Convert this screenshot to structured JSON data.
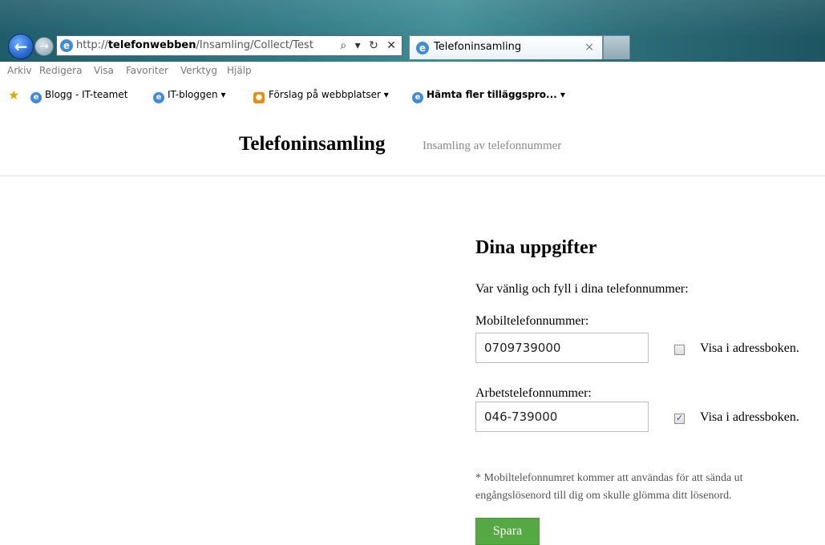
{
  "browser": {
    "url_prefix": "http://",
    "url_host": "telefonwebben",
    "url_path": "/Insamling/Collect/Test",
    "address_tools": "⌕ ▾ ↻ ✕",
    "tab_title": "Telefoninsamling",
    "tab_close": "×",
    "back_icon": "←",
    "forward_icon": "→",
    "ie_glyph": "e"
  },
  "menubar": {
    "items": [
      "Arkiv",
      "Redigera",
      "Visa",
      "Favoriter",
      "Verktyg",
      "Hjälp"
    ]
  },
  "favorites": {
    "star_icon": "★",
    "items": [
      {
        "label": "Blogg - IT-teamet",
        "arrow": ""
      },
      {
        "label": "IT-bloggen",
        "arrow": "▾"
      },
      {
        "label": "Förslag på webbplatser",
        "arrow": "▾"
      },
      {
        "label": "Hämta fler tilläggspro...",
        "arrow": "▾"
      }
    ]
  },
  "header": {
    "brand": "Telefoninsamling",
    "tagline": "Insamling av telefonnummer"
  },
  "form": {
    "heading": "Dina uppgifter",
    "intro": "Var vänlig och fyll i dina telefonnummer:",
    "mobile": {
      "label": "Mobiltelefonnummer:",
      "value": "0709739000",
      "checked": false,
      "check_label": "Visa i adressboken."
    },
    "work": {
      "label": "Arbetstelefonnummer:",
      "value": "046-739000",
      "checked": true,
      "check_label": "Visa i adressboken."
    },
    "note": "* Mobiltelefonnumret kommer att användas för att sända ut engångslösenord till dig om skulle glömma ditt lösenord.",
    "save_label": "Spara"
  },
  "colors": {
    "save_button": "#55a943",
    "chrome": "#2f7a85"
  }
}
